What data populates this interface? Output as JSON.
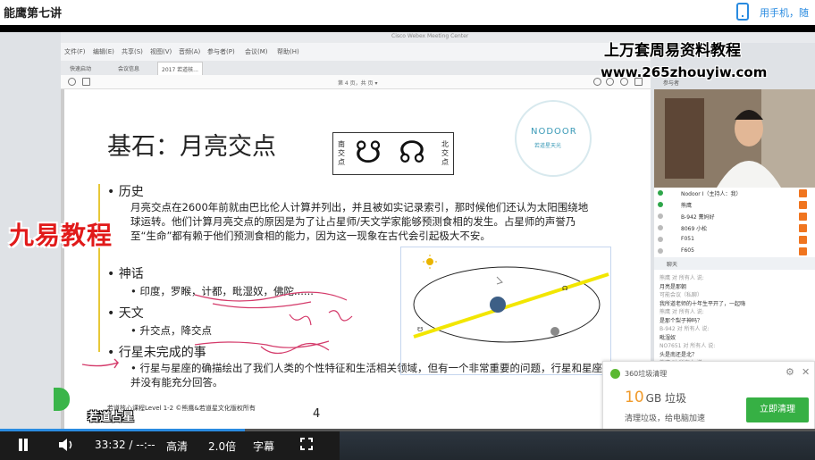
{
  "page": {
    "title": "能鹰第七讲",
    "phone_link": "用手机，随"
  },
  "app": {
    "title": "Cisco Webex Meeting Center",
    "menu": [
      "文件(F)",
      "编辑(E)",
      "共享(S)",
      "视图(V)",
      "音频(A)",
      "参与者(P)",
      "会议(M)",
      "帮助(H)"
    ],
    "tabs": [
      "快速启动",
      "会议信息",
      "2017 若道核..."
    ],
    "page_indicator": "第 4 页，共 页 ▾",
    "right_toolbar_label": "参与者"
  },
  "slide": {
    "title": "基石：月亮交点",
    "node_south": "南交点",
    "node_north": "北交点",
    "node_symbols": "☋ ☊",
    "logo_text": "NODOOR",
    "logo_sub": "若道星天光",
    "bullets": {
      "history": "历史",
      "history_text": "月亮交点在2600年前就由巴比伦人计算并列出，并且被如实记录索引，那时候他们还认为太阳围绕地球运转。他们计算月亮交点的原因是为了让占星师/天文学家能够预测食相的发生。占星师的声誉乃至“生命”都有赖于他们预测食相的能力，因为这一现象在古代会引起极大不安。",
      "myth": "神话",
      "myth_text": "印度，罗睺，计都，毗湿奴，佛陀......",
      "astronomy": "天文",
      "astronomy_text": "升交点，降交点",
      "planet": "行星未完成的事",
      "planet_text": "行星与星座的确描绘出了我们人类的个性特征和生活相关领域，但有一个非常重要的问题，行星和星座并没有能充分回答。"
    },
    "footer": "若道核心课程Level 1-2  ©熊鹰&若道星文化版权所有",
    "page_number": "4"
  },
  "participants": [
    {
      "name": "Nodoor I（主持人：我）",
      "status": "#2ea64a"
    },
    {
      "name": "熊鹰",
      "status": "#2ea64a"
    },
    {
      "name": "B-942 薰妈好",
      "status": "#bbb"
    },
    {
      "name": "8069 小松",
      "status": "#bbb"
    },
    {
      "name": "F051",
      "status": "#bbb"
    },
    {
      "name": "F605",
      "status": "#bbb"
    }
  ],
  "chat": {
    "header": "聊天",
    "lines": [
      {
        "text": "熊鹰 对 所有人 说:",
        "meta": true
      },
      {
        "text": "月亮是那朝",
        "meta": false
      },
      {
        "text": "可能会议（私聊）",
        "meta": true
      },
      {
        "text": "我所道老师的十年生平开了，一起嗨",
        "meta": false
      },
      {
        "text": "熊鹰 对 所有人 说:",
        "meta": true
      },
      {
        "text": "是那个梨子神吗？",
        "meta": false
      },
      {
        "text": "B-942 对 所有人 说:",
        "meta": true
      },
      {
        "text": "毗湿奴",
        "meta": false
      },
      {
        "text": "NO7651 对 所有人 说:",
        "meta": true
      },
      {
        "text": "头是南还是北？",
        "meta": false
      },
      {
        "text": "熊鹰 对 所有人 说:",
        "meta": true
      }
    ]
  },
  "watermarks": {
    "top": "上万套周易资料教程",
    "url": "www.265zhouyiw.com",
    "left": "九易教程",
    "bottom": "若道占星"
  },
  "popup": {
    "title": "360垃圾清理",
    "size_number": "10",
    "size_unit": "GB 垃圾",
    "desc": "清理垃圾，给电脑加速",
    "button": "立即清理"
  },
  "player": {
    "time": "33:32 / --:--",
    "quality": "高清",
    "speed": "2.0倍",
    "subtitle": "字幕",
    "progress_percent": 30
  },
  "colors": {
    "accent": "#2a8be0",
    "watermark_red": "#e11a1a",
    "orbit_line": "#f2e600",
    "popup_green": "#36b044"
  }
}
